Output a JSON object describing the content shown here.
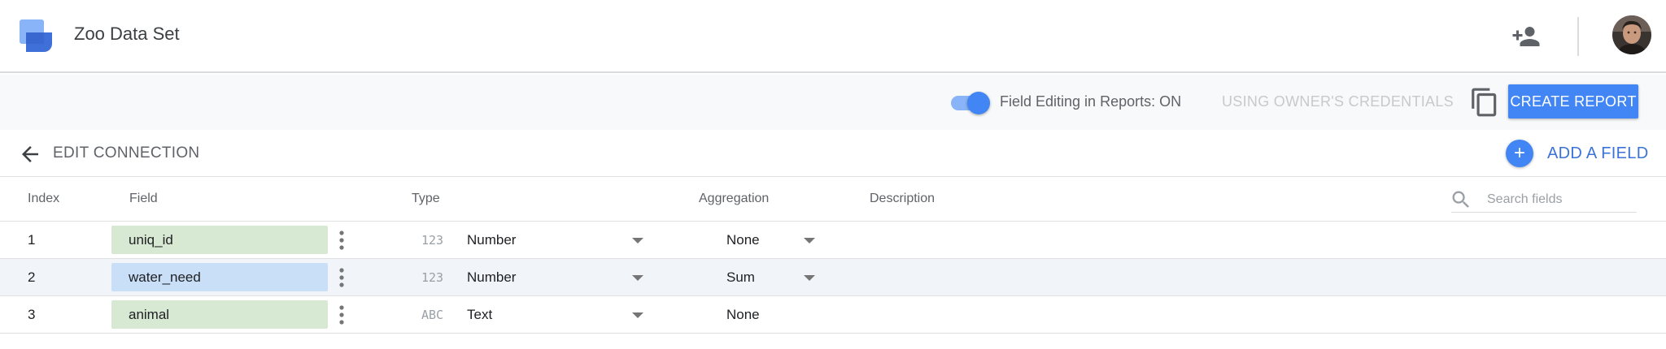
{
  "app": {
    "title": "Zoo Data Set",
    "logo_icon": "data-studio-logo-icon",
    "share_icon": "person-add-icon",
    "avatar_icon": "user-avatar"
  },
  "toolbar": {
    "field_editing_toggle_on": true,
    "field_editing_label": "Field Editing in Reports: ON",
    "credentials_label": "USING OWNER'S CREDENTIALS",
    "copy_icon": "copy-icon",
    "create_report_label": "CREATE REPORT"
  },
  "edit_bar": {
    "back_icon": "arrow-back-icon",
    "title": "EDIT CONNECTION",
    "add_field_icon": "+",
    "add_field_label": "ADD A FIELD"
  },
  "table": {
    "columns": {
      "index": "Index",
      "field": "Field",
      "type": "Type",
      "aggregation": "Aggregation",
      "description": "Description"
    },
    "search": {
      "placeholder": "Search fields",
      "value": ""
    },
    "rows": [
      {
        "index": "1",
        "field": "uniq_id",
        "field_kind": "dimension",
        "type_icon": "123",
        "type": "Number",
        "aggregation": "None",
        "aggregation_editable": true
      },
      {
        "index": "2",
        "field": "water_need",
        "field_kind": "metric",
        "type_icon": "123",
        "type": "Number",
        "aggregation": "Sum",
        "aggregation_editable": true
      },
      {
        "index": "3",
        "field": "animal",
        "field_kind": "dimension",
        "type_icon": "ABC",
        "type": "Text",
        "aggregation": "None",
        "aggregation_editable": false
      }
    ]
  },
  "colors": {
    "accent": "#4285f4",
    "accent_text": "#3b73d9",
    "dimension_chip": "#d7e8d3",
    "metric_chip": "#c9dff7",
    "toggle_track": "#8ab4f8"
  }
}
